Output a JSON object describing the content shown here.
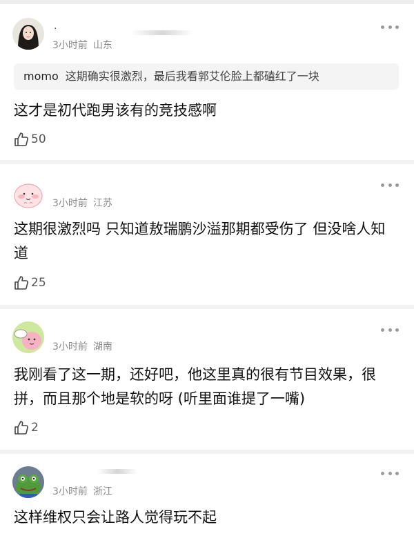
{
  "comments": [
    {
      "username": ".",
      "time": "3小时前",
      "location": "山东",
      "quote": {
        "name": "momo",
        "text": "这期确实很激烈，最后我看郭艾伦脸上都磕红了一块"
      },
      "body_lines": [
        "这才是初代跑男该有的竞技感啊"
      ],
      "likes": "50",
      "avatar_icon": "girl-portrait-avatar"
    },
    {
      "time": "3小时前",
      "location": "江苏",
      "body_lines": [
        "这期很激烈吗 只知道敖瑞鹏沙溢那期都受伤了 但没啥人知",
        "道"
      ],
      "likes": "25",
      "avatar_icon": "pink-seal-avatar"
    },
    {
      "time": "3小时前",
      "location": "湖南",
      "body_lines": [
        "我刚看了这一期，还好吧，他这里真的很有节目效果，很",
        "拼，而且那个地是软的呀 (听里面谁提了一嘴)"
      ],
      "likes": "2",
      "avatar_icon": "cartoon-sticker-avatar"
    },
    {
      "time": "3小时前",
      "location": "浙江",
      "body_lines": [
        "这样维权只会让路人觉得玩不起"
      ],
      "avatar_icon": "frog-avatar"
    }
  ],
  "colors": {
    "meta": "#8a8a8a",
    "divider": "#f1f1f1",
    "quote_bg": "#f4f4f4"
  }
}
